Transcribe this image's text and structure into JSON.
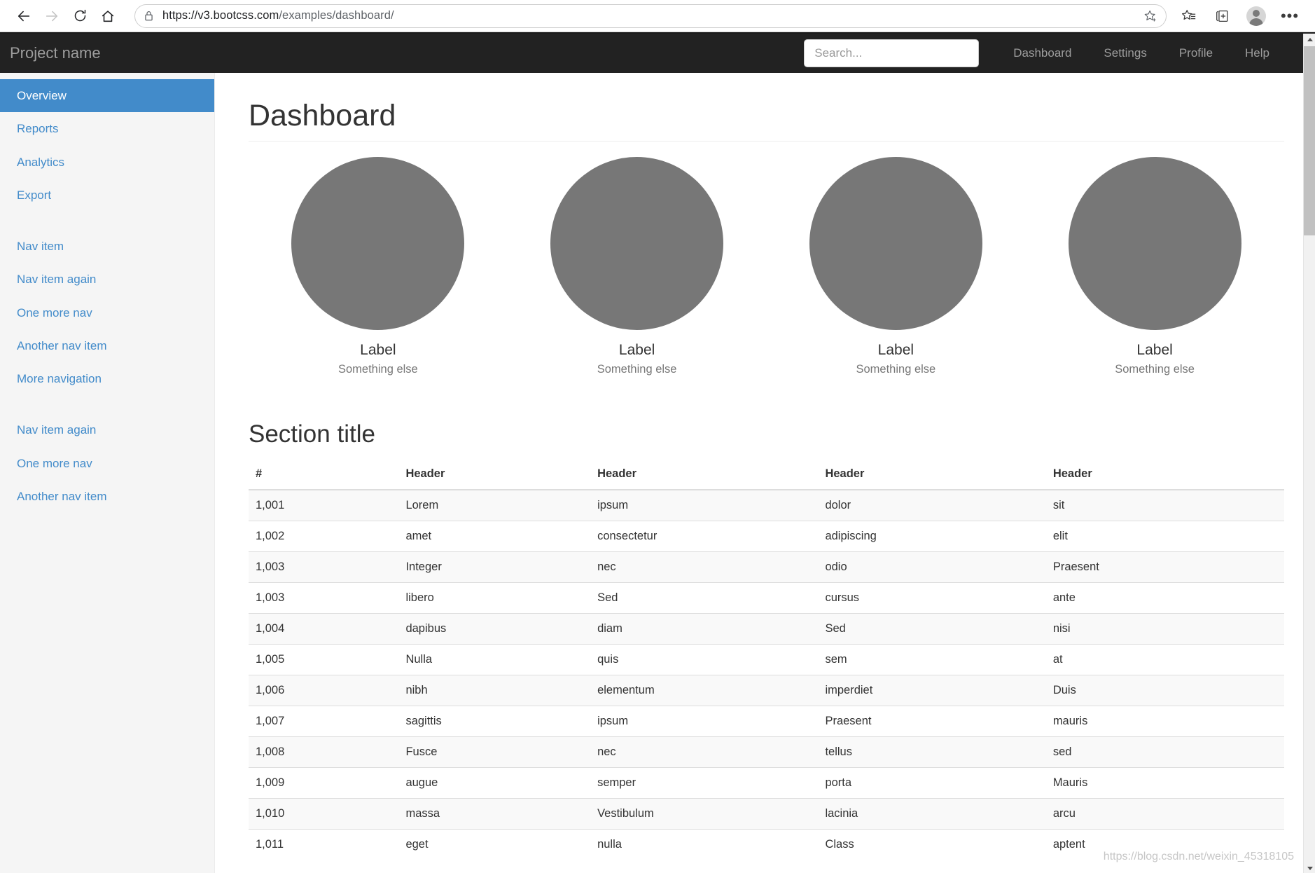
{
  "browser": {
    "back_icon": "back-arrow-icon",
    "forward_icon": "forward-arrow-icon",
    "refresh_icon": "refresh-icon",
    "home_icon": "home-icon",
    "lock_icon": "lock-icon",
    "url_scheme": "https://",
    "url_domain": "v3.bootcss.com",
    "url_path": "/examples/dashboard/",
    "url_full": "https://v3.bootcss.com/examples/dashboard/",
    "add_favorite_icon": "star-plus-icon",
    "favorites_icon": "favorites-list-icon",
    "collections_icon": "collections-icon",
    "profile_icon": "profile-avatar-icon",
    "settings_icon": "more-options-icon",
    "settings_label": "•••"
  },
  "navbar": {
    "brand": "Project name",
    "search_placeholder": "Search...",
    "search_value": "",
    "links": [
      {
        "label": "Dashboard"
      },
      {
        "label": "Settings"
      },
      {
        "label": "Profile"
      },
      {
        "label": "Help"
      }
    ]
  },
  "sidebar": {
    "groups": [
      {
        "items": [
          {
            "label": "Overview",
            "active": true
          },
          {
            "label": "Reports",
            "active": false
          },
          {
            "label": "Analytics",
            "active": false
          },
          {
            "label": "Export",
            "active": false
          }
        ]
      },
      {
        "items": [
          {
            "label": "Nav item",
            "active": false
          },
          {
            "label": "Nav item again",
            "active": false
          },
          {
            "label": "One more nav",
            "active": false
          },
          {
            "label": "Another nav item",
            "active": false
          },
          {
            "label": "More navigation",
            "active": false
          }
        ]
      },
      {
        "items": [
          {
            "label": "Nav item again",
            "active": false
          },
          {
            "label": "One more nav",
            "active": false
          },
          {
            "label": "Another nav item",
            "active": false
          }
        ]
      }
    ]
  },
  "main": {
    "page_title": "Dashboard",
    "section_title": "Section title",
    "placeholders": [
      {
        "label": "Label",
        "sub": "Something else"
      },
      {
        "label": "Label",
        "sub": "Something else"
      },
      {
        "label": "Label",
        "sub": "Something else"
      },
      {
        "label": "Label",
        "sub": "Something else"
      }
    ],
    "table": {
      "headers": [
        "#",
        "Header",
        "Header",
        "Header",
        "Header"
      ],
      "rows": [
        [
          "1,001",
          "Lorem",
          "ipsum",
          "dolor",
          "sit"
        ],
        [
          "1,002",
          "amet",
          "consectetur",
          "adipiscing",
          "elit"
        ],
        [
          "1,003",
          "Integer",
          "nec",
          "odio",
          "Praesent"
        ],
        [
          "1,003",
          "libero",
          "Sed",
          "cursus",
          "ante"
        ],
        [
          "1,004",
          "dapibus",
          "diam",
          "Sed",
          "nisi"
        ],
        [
          "1,005",
          "Nulla",
          "quis",
          "sem",
          "at"
        ],
        [
          "1,006",
          "nibh",
          "elementum",
          "imperdiet",
          "Duis"
        ],
        [
          "1,007",
          "sagittis",
          "ipsum",
          "Praesent",
          "mauris"
        ],
        [
          "1,008",
          "Fusce",
          "nec",
          "tellus",
          "sed"
        ],
        [
          "1,009",
          "augue",
          "semper",
          "porta",
          "Mauris"
        ],
        [
          "1,010",
          "massa",
          "Vestibulum",
          "lacinia",
          "arcu"
        ],
        [
          "1,011",
          "eget",
          "nulla",
          "Class",
          "aptent"
        ]
      ]
    }
  },
  "watermark": "https://blog.csdn.net/weixin_45318105",
  "colors": {
    "accent": "#428bca",
    "navbar_bg": "#222222",
    "sidebar_bg": "#f5f5f5",
    "placeholder_fill": "#777777"
  }
}
